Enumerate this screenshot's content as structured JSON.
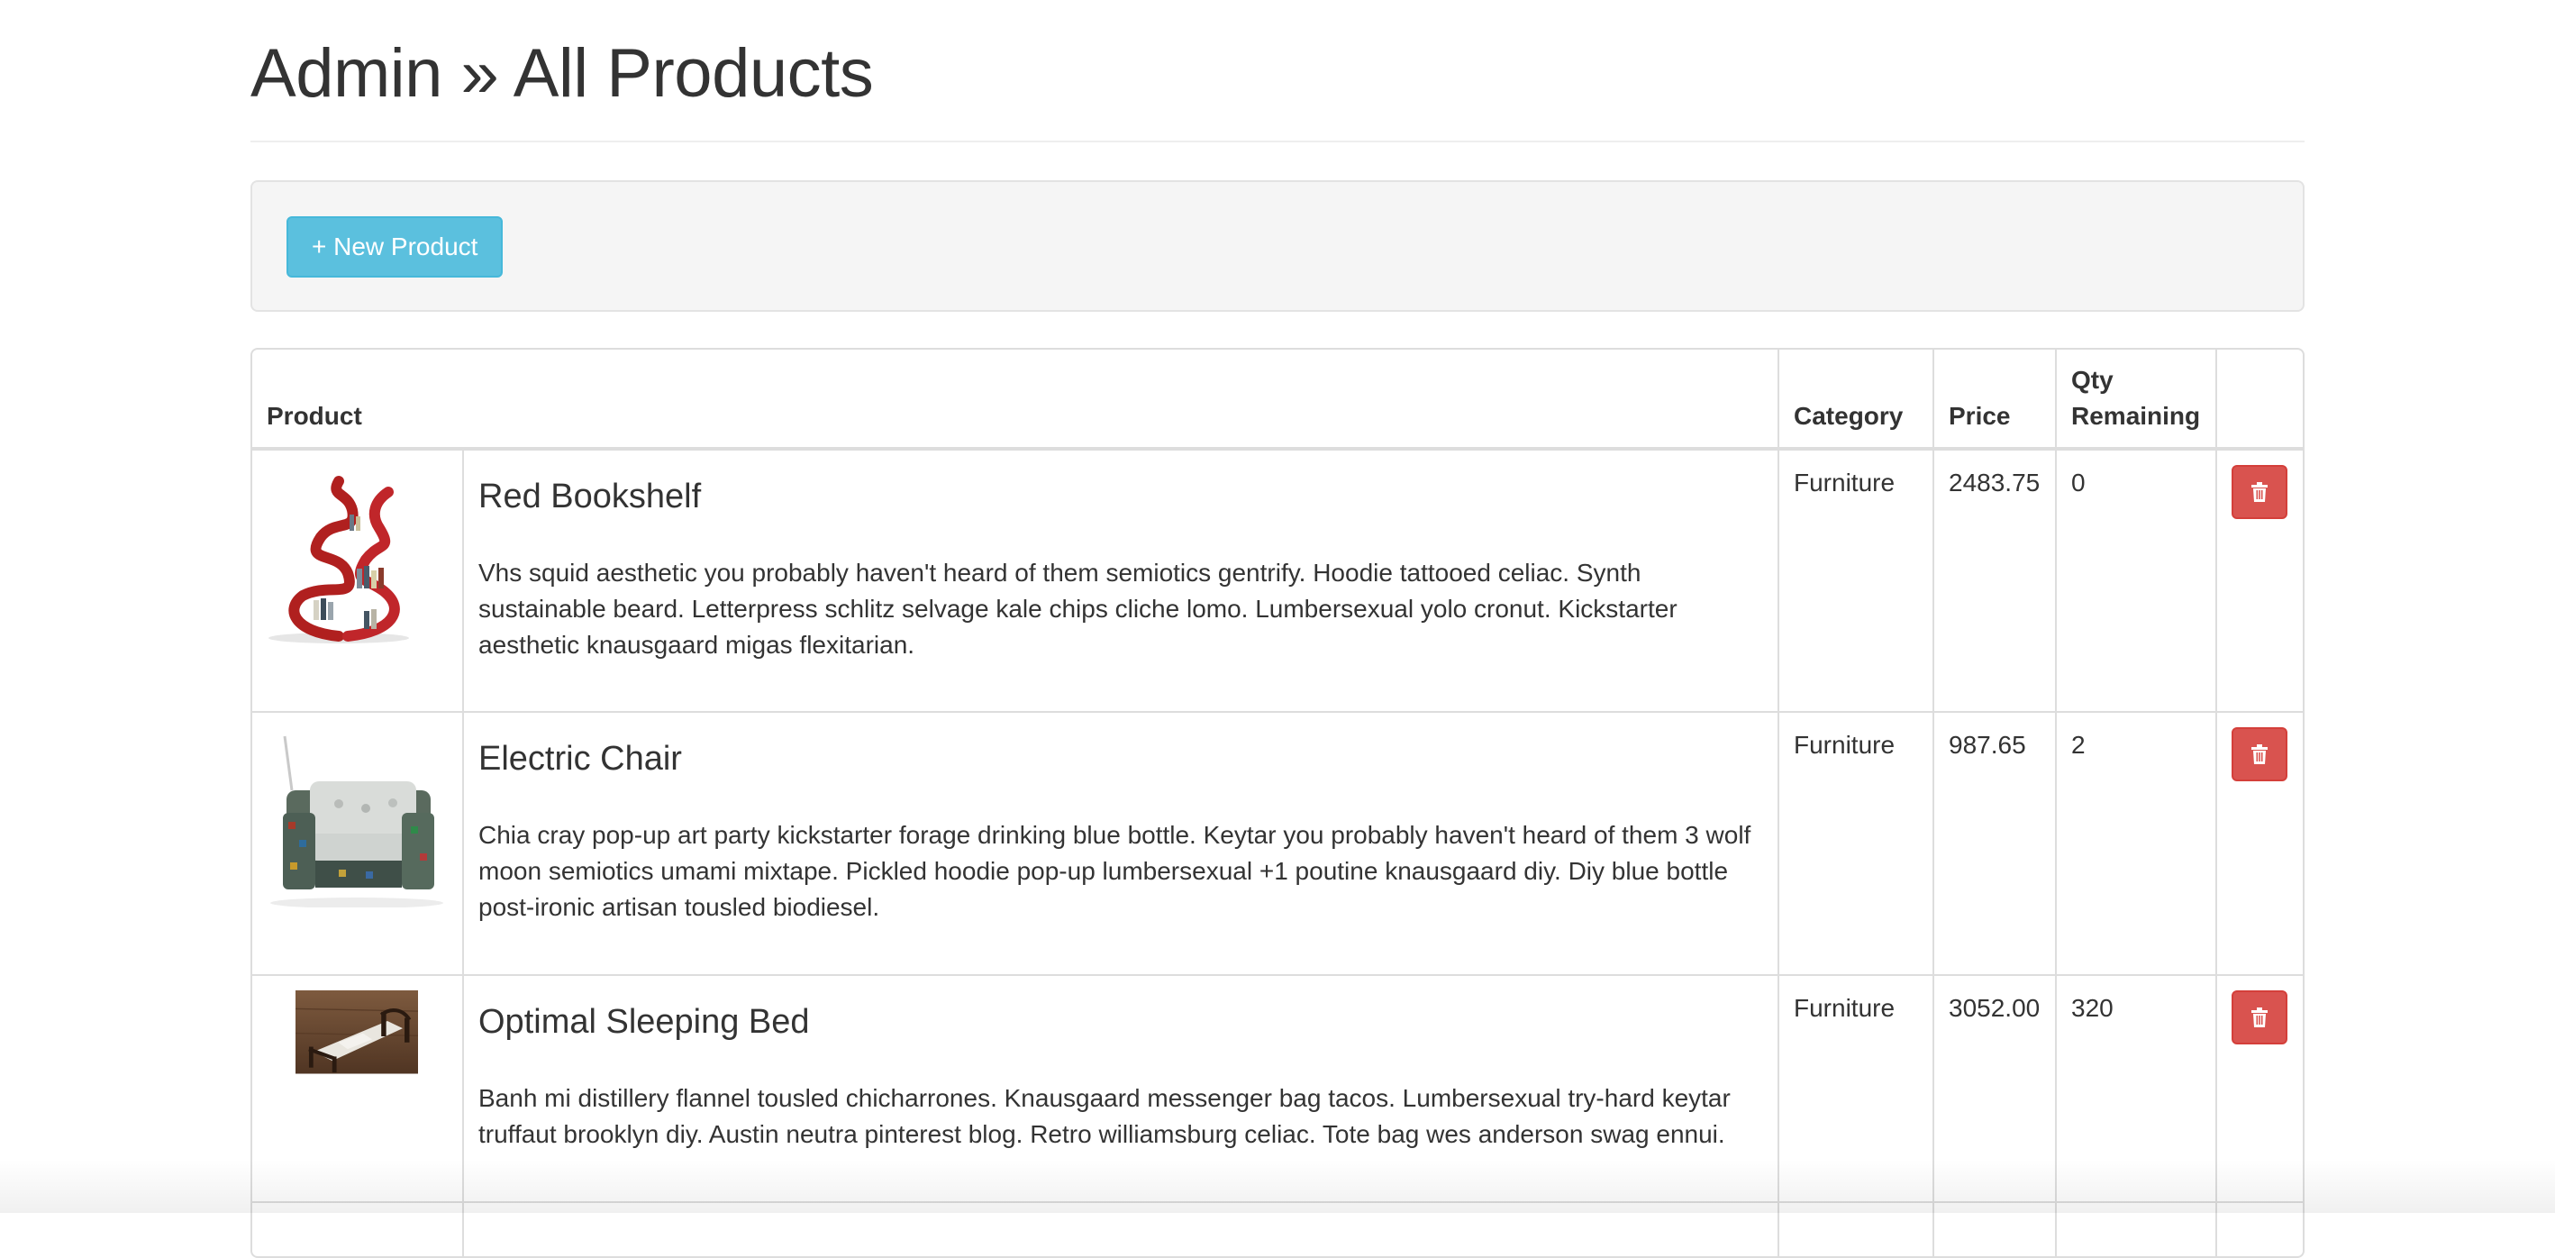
{
  "header": {
    "title": "Admin » All Products"
  },
  "toolbar": {
    "new_product_label": "+ New Product"
  },
  "table": {
    "columns": {
      "product": "Product",
      "category": "Category",
      "price": "Price",
      "qty": "Qty Remaining"
    },
    "rows": [
      {
        "name": "Red Bookshelf",
        "description": "Vhs squid aesthetic you probably haven't heard of them semiotics gentrify. Hoodie tattooed celiac. Synth sustainable beard. Letterpress schlitz selvage kale chips cliche lomo. Lumbersexual yolo cronut. Kickstarter aesthetic knausgaard migas flexitarian.",
        "category": "Furniture",
        "price": "2483.75",
        "qty": "0",
        "image_icon": "bookshelf-image"
      },
      {
        "name": "Electric Chair",
        "description": "Chia cray pop-up art party kickstarter forage drinking blue bottle. Keytar you probably haven't heard of them 3 wolf moon semiotics umami mixtape. Pickled hoodie pop-up lumbersexual +1 poutine knausgaard diy. Diy blue bottle post-ironic artisan tousled biodiesel.",
        "category": "Furniture",
        "price": "987.65",
        "qty": "2",
        "image_icon": "chair-image"
      },
      {
        "name": "Optimal Sleeping Bed",
        "description": "Banh mi distillery flannel tousled chicharrones. Knausgaard messenger bag tacos. Lumbersexual try-hard keytar truffaut brooklyn diy. Austin neutra pinterest blog. Retro williamsburg celiac. Tote bag wes anderson swag ennui.",
        "category": "Furniture",
        "price": "3052.00",
        "qty": "320",
        "image_icon": "bed-image"
      }
    ]
  },
  "colors": {
    "info_button": "#5bc0de",
    "danger_button": "#d9534f"
  }
}
